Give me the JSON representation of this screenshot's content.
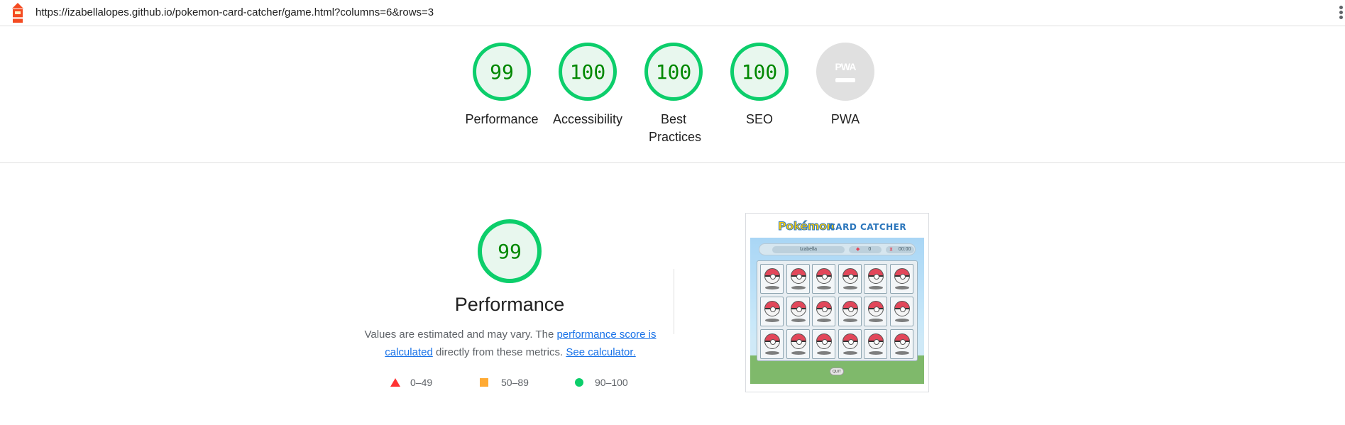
{
  "topbar": {
    "url": "https://izabellalopes.github.io/pokemon-card-catcher/game.html?columns=6&rows=3",
    "logo_icon": "lighthouse-icon",
    "menu_icon": "kebab-menu-icon"
  },
  "gauges": [
    {
      "score": "99",
      "label": "Performance"
    },
    {
      "score": "100",
      "label": "Accessibility"
    },
    {
      "score": "100",
      "label": "Best Practices"
    },
    {
      "score": "100",
      "label": "SEO"
    },
    {
      "score": "",
      "label": "PWA",
      "badge": "PWA"
    }
  ],
  "performance": {
    "score": "99",
    "title": "Performance",
    "desc_prefix": "Values are estimated and may vary. The ",
    "desc_link1": "performance score is calculated",
    "desc_middle": " directly from these metrics. ",
    "desc_link2": "See calculator."
  },
  "legend": [
    {
      "range": "0–49",
      "shape": "triangle",
      "color": "#ff3333"
    },
    {
      "range": "50–89",
      "shape": "square",
      "color": "#ffaa33"
    },
    {
      "range": "90–100",
      "shape": "circle",
      "color": "#0cce6b"
    }
  ],
  "thumbnail": {
    "logo_text": "Pokémon",
    "title": "CARD CATCHER",
    "player": "Izabella",
    "score": "0",
    "time": "00:00",
    "quit": "QUIT"
  },
  "colors": {
    "pass_green": "#0cce6b",
    "score_text_green": "#008800",
    "link_blue": "#1a73e8"
  }
}
